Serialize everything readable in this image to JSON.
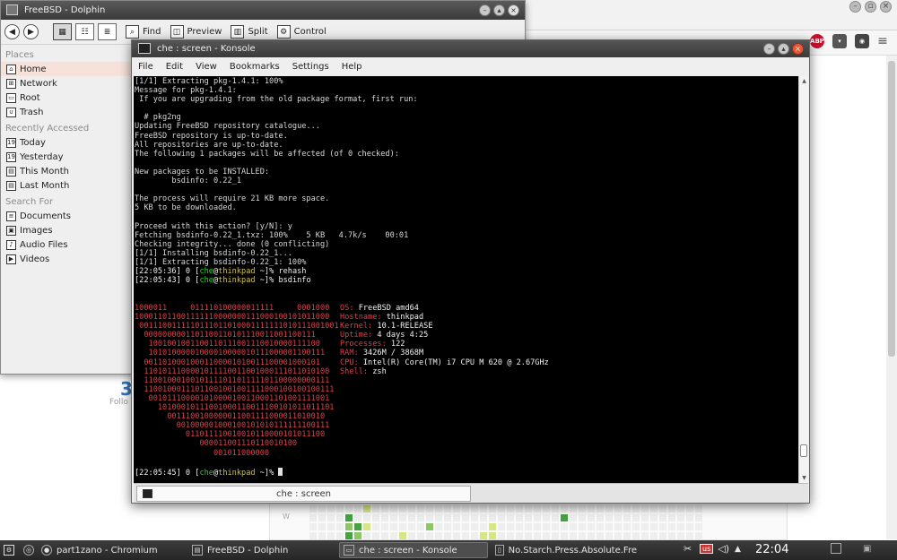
{
  "chromium": {
    "extensions": [
      "abp-icon",
      "pocket-icon",
      "spy-icon",
      "menu-icon"
    ],
    "abp_label": "ABP",
    "profile_number": "3",
    "profile_sub": "Follo",
    "contrib_day_label": "W",
    "contrib_levels": [
      0,
      0,
      0,
      0,
      0,
      0,
      1,
      0,
      0,
      0,
      0,
      0,
      0,
      0,
      0,
      0,
      0,
      0,
      0,
      0,
      0,
      0,
      0,
      0,
      0,
      0,
      0,
      0,
      0,
      0,
      0,
      0,
      0,
      0,
      0,
      0,
      0,
      0,
      0,
      0,
      0,
      0,
      0,
      0,
      0,
      0,
      0,
      0,
      3,
      0,
      0,
      0,
      0,
      0,
      0,
      0,
      0,
      0,
      0,
      0,
      0,
      0,
      0,
      0,
      0,
      0,
      0,
      0,
      0,
      0,
      0,
      0,
      3,
      0,
      0,
      0,
      0,
      0,
      0,
      0,
      0,
      0,
      0,
      0,
      0,
      0,
      0,
      0,
      0,
      0,
      0,
      0,
      2,
      3,
      1,
      0,
      0,
      0,
      0,
      0,
      0,
      2,
      0,
      0,
      0,
      0,
      0,
      0,
      1,
      0,
      0,
      0,
      0,
      0,
      0,
      0,
      0,
      0,
      0,
      0,
      0,
      0,
      0,
      0,
      0,
      0,
      0,
      0,
      0,
      0,
      0,
      0,
      0,
      0,
      0,
      0,
      3,
      2,
      0,
      0,
      0,
      0,
      1,
      0,
      0,
      0,
      0,
      0,
      0,
      0,
      0,
      1,
      1,
      0,
      0,
      0,
      0,
      0,
      0,
      0,
      0,
      0,
      0,
      0,
      0,
      0,
      0,
      0,
      0,
      0,
      0,
      0,
      0,
      0,
      0,
      0
    ]
  },
  "dolphin": {
    "title": "FreeBSD - Dolphin",
    "back_icon": "◀",
    "forward_icon": "▶",
    "toolbar": [
      {
        "label": "Find",
        "icon": "search-icon",
        "glyph": "⌕"
      },
      {
        "label": "Preview",
        "icon": "preview-icon",
        "glyph": "◫"
      },
      {
        "label": "Split",
        "icon": "split-icon",
        "glyph": "▥"
      },
      {
        "label": "Control",
        "icon": "control-icon",
        "glyph": "⚙"
      }
    ],
    "sections": [
      {
        "heading": "Places",
        "items": [
          {
            "label": "Home",
            "icon": "home-icon",
            "glyph": "⌂"
          },
          {
            "label": "Network",
            "icon": "network-icon",
            "glyph": "⊞"
          },
          {
            "label": "Root",
            "icon": "root-icon",
            "glyph": "▭"
          },
          {
            "label": "Trash",
            "icon": "trash-icon",
            "glyph": "∪"
          }
        ]
      },
      {
        "heading": "Recently Accessed",
        "items": [
          {
            "label": "Today",
            "icon": "calendar-icon",
            "glyph": "19"
          },
          {
            "label": "Yesterday",
            "icon": "calendar-icon",
            "glyph": "19"
          },
          {
            "label": "This Month",
            "icon": "calendar-icon",
            "glyph": "▤"
          },
          {
            "label": "Last Month",
            "icon": "calendar-icon",
            "glyph": "▤"
          }
        ]
      },
      {
        "heading": "Search For",
        "items": [
          {
            "label": "Documents",
            "icon": "documents-icon",
            "glyph": "≡"
          },
          {
            "label": "Images",
            "icon": "images-icon",
            "glyph": "▣"
          },
          {
            "label": "Audio Files",
            "icon": "audio-icon",
            "glyph": "♪"
          },
          {
            "label": "Videos",
            "icon": "videos-icon",
            "glyph": "▶"
          }
        ]
      }
    ]
  },
  "konsole": {
    "title": "che : screen - Konsole",
    "menu": [
      "File",
      "Edit",
      "View",
      "Bookmarks",
      "Settings",
      "Help"
    ],
    "tab_label": "che : screen",
    "output": [
      "[1/1] Extracting pkg-1.4.1: 100%",
      "Message for pkg-1.4.1:",
      " If you are upgrading from the old package format, first run:",
      "",
      "  # pkg2ng",
      "Updating FreeBSD repository catalogue...",
      "FreeBSD repository is up-to-date.",
      "All repositories are up-to-date.",
      "The following 1 packages will be affected (of 0 checked):",
      "",
      "New packages to be INSTALLED:",
      "        bsdinfo: 0.22_1",
      "",
      "The process will require 21 KB more space.",
      "5 KB to be downloaded.",
      "",
      "Proceed with this action? [y/N]: y",
      "Fetching bsdinfo-0.22_1.txz: 100%    5 KB   4.7k/s    00:01",
      "Checking integrity... done (0 conflicting)",
      "[1/1] Installing bsdinfo-0.22_1...",
      "[1/1] Extracting bsdinfo-0.22_1: 100%"
    ],
    "prompts": [
      {
        "time": "22:05:36",
        "status": "0",
        "user": "che",
        "host": "thinkpad",
        "dir": "~",
        "cmd": "rehash"
      },
      {
        "time": "22:05:43",
        "status": "0",
        "user": "che",
        "host": "thinkpad",
        "dir": "~",
        "cmd": "bsdinfo"
      }
    ],
    "logo": [
      "1000011     011110100000011111     0001000",
      "100011011001111110000000111000100101011000",
      " 0011100111110111011010001111111010111001001",
      "  0000000001101100110101110011001100111",
      "   1001001001100110111001110010000111100",
      "   10101000001000010000010111000001100111",
      "  00110100010001100001010011100001000101",
      "  1101011100001011110011001000111011010100",
      "  1100100010010111101101111101100000000111",
      "  11001000111011001001001111000100100100111",
      "   001011100001010000100110001101001111001",
      "     10100010111001000110011100101011011101",
      "       0011100100000011001111000011010010",
      "         001000001000100101010111111100111",
      "           011011110010010110000101011100",
      "              000011001110110010100",
      "                 001011000000"
    ],
    "info": [
      {
        "key": "OS:",
        "val": "FreeBSD amd64"
      },
      {
        "key": "Hostname:",
        "val": "thinkpad"
      },
      {
        "key": "Kernel:",
        "val": "10.1-RELEASE"
      },
      {
        "key": "Uptime:",
        "val": "4 days 4:25"
      },
      {
        "key": "Processes:",
        "val": "122"
      },
      {
        "key": "RAM:",
        "val": "3426M / 3868M"
      },
      {
        "key": "CPU:",
        "val": "Intel(R) Core(TM) i7 CPU M 620 @ 2.67GHz"
      },
      {
        "key": "Shell:",
        "val": "zsh"
      }
    ],
    "final_prompt": {
      "time": "22:05:45",
      "status": "0",
      "user": "che",
      "host": "thinkpad",
      "dir": "~",
      "cmd": ""
    }
  },
  "taskbar": {
    "tasks": [
      {
        "label": "part1zano - Chromium",
        "icon": "chromium-icon"
      },
      {
        "label": "FreeBSD - Dolphin",
        "icon": "dolphin-icon"
      },
      {
        "label": "che : screen - Konsole",
        "icon": "konsole-icon",
        "active": true
      },
      {
        "label": "No.Starch.Press.Absolute.Fre",
        "icon": "document-icon"
      }
    ],
    "layout_badge": "us",
    "clock": "22:04"
  },
  "colors": {
    "prompt_user": "#33cc33",
    "prompt_host": "#d2c23c",
    "logo_red": "#d9404a",
    "info_value": "#f0f0f0"
  }
}
